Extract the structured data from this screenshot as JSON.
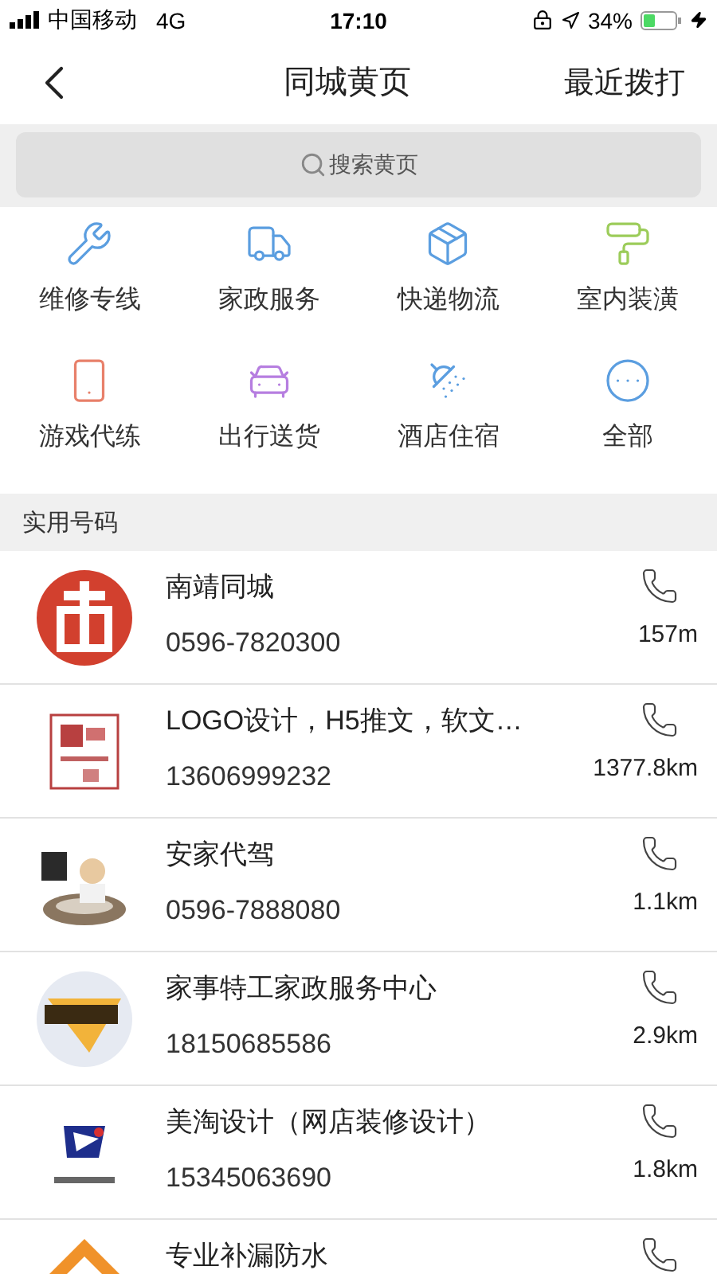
{
  "status_bar": {
    "carrier": "中国移动",
    "network": "4G",
    "time": "17:10",
    "battery": "34%"
  },
  "nav": {
    "title": "同城黄页",
    "action": "最近拨打"
  },
  "search": {
    "placeholder": "搜索黄页"
  },
  "categories": [
    {
      "label": "维修专线"
    },
    {
      "label": "家政服务"
    },
    {
      "label": "快递物流"
    },
    {
      "label": "室内装潢"
    },
    {
      "label": "游戏代练"
    },
    {
      "label": "出行送货"
    },
    {
      "label": "酒店住宿"
    },
    {
      "label": "全部"
    }
  ],
  "section_title": "实用号码",
  "listings": [
    {
      "name": "南靖同城",
      "phone": "0596-7820300",
      "distance": "157m"
    },
    {
      "name": "LOGO设计，H5推文，软文…",
      "phone": "13606999232",
      "distance": "1377.8km"
    },
    {
      "name": "安家代驾",
      "phone": "0596-7888080",
      "distance": "1.1km"
    },
    {
      "name": "家事特工家政服务中心",
      "phone": "18150685586",
      "distance": "2.9km"
    },
    {
      "name": "美淘设计（网店装修设计）",
      "phone": "15345063690",
      "distance": "1.8km"
    },
    {
      "name": "专业补漏防水"
    }
  ]
}
